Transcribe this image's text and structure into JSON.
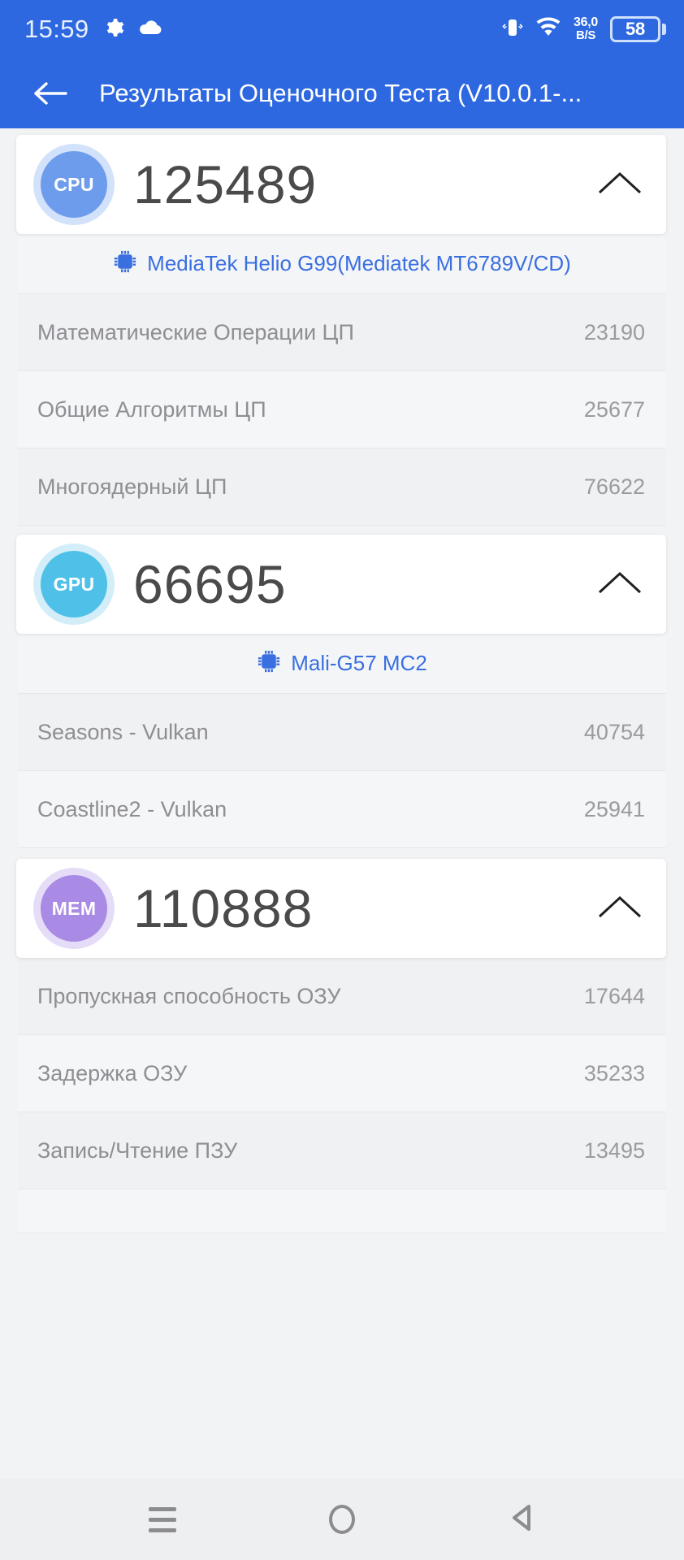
{
  "statusbar": {
    "time": "15:59",
    "icons_left": [
      "gear-icon",
      "cloud-icon"
    ],
    "icons_right": [
      "vibrate-icon",
      "wifi-icon"
    ],
    "netspeed_value": "36,0",
    "netspeed_unit": "B/S",
    "battery_level": "58"
  },
  "appbar": {
    "back_icon": "back-arrow-icon",
    "title": "Результаты Оценочного Теста (V10.0.1-..."
  },
  "theme": {
    "primary": "#2d68e0",
    "link": "#3a6fe0",
    "cpu_badge": "#6e9ced",
    "gpu_badge": "#4fc0e8",
    "mem_badge": "#a98ae4",
    "score_text": "#4a4a4a",
    "row_label": "#8e8e93"
  },
  "sections": [
    {
      "key": "cpu",
      "badge_label": "CPU",
      "score": "125489",
      "collapse_icon": "chevron-up-icon",
      "chip_icon": "cpu-chip-icon",
      "chip_name": "MediaTek Helio G99(Mediatek MT6789V/CD)",
      "rows": [
        {
          "label": "Математические Операции ЦП",
          "value": "23190"
        },
        {
          "label": "Общие Алгоритмы ЦП",
          "value": "25677"
        },
        {
          "label": "Многоядерный ЦП",
          "value": "76622"
        }
      ]
    },
    {
      "key": "gpu",
      "badge_label": "GPU",
      "score": "66695",
      "collapse_icon": "chevron-up-icon",
      "chip_icon": "gpu-chip-icon",
      "chip_name": "Mali-G57 MC2",
      "rows": [
        {
          "label": "Seasons - Vulkan",
          "value": "40754"
        },
        {
          "label": "Coastline2 - Vulkan",
          "value": "25941"
        }
      ]
    },
    {
      "key": "mem",
      "badge_label": "MEM",
      "score": "110888",
      "collapse_icon": "chevron-up-icon",
      "chip_icon": null,
      "chip_name": null,
      "rows": [
        {
          "label": "Пропускная способность ОЗУ",
          "value": "17644"
        },
        {
          "label": "Задержка ОЗУ",
          "value": "35233"
        },
        {
          "label": "Запись/Чтение ПЗУ",
          "value": "13495"
        }
      ]
    }
  ],
  "navbar": {
    "items": [
      {
        "name": "recents-button",
        "icon": "menu-icon"
      },
      {
        "name": "home-button",
        "icon": "circle-icon"
      },
      {
        "name": "back-button",
        "icon": "triangle-left-icon"
      }
    ]
  }
}
